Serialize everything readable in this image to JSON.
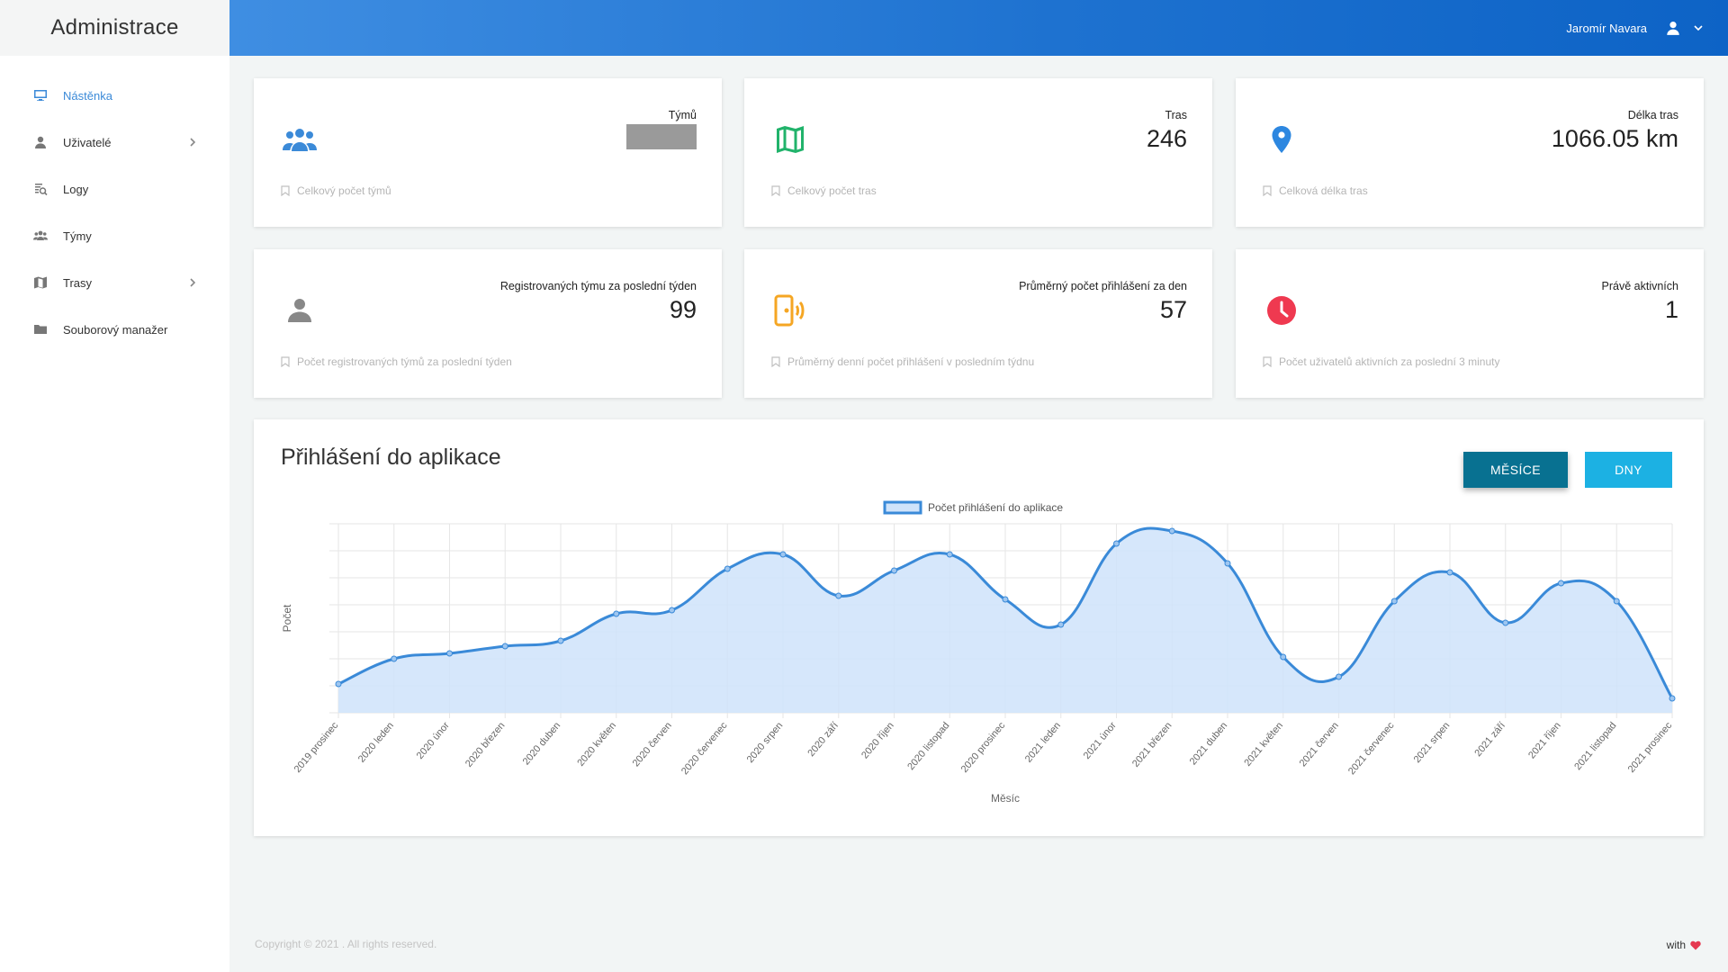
{
  "sidebar": {
    "brand": "Administrace",
    "items": [
      {
        "label": "Nástěnka",
        "icon": "monitor-icon",
        "active": true,
        "has_children": false
      },
      {
        "label": "Uživatelé",
        "icon": "user-icon",
        "active": false,
        "has_children": true
      },
      {
        "label": "Logy",
        "icon": "log-search-icon",
        "active": false,
        "has_children": false
      },
      {
        "label": "Týmy",
        "icon": "team-icon",
        "active": false,
        "has_children": false
      },
      {
        "label": "Trasy",
        "icon": "map-icon",
        "active": false,
        "has_children": true
      },
      {
        "label": "Souborový manažer",
        "icon": "folder-icon",
        "active": false,
        "has_children": false
      }
    ]
  },
  "header": {
    "user_name": "Jaromír Navara"
  },
  "stats": [
    {
      "title": "Týmů",
      "value": "",
      "redacted": true,
      "footer": "Celkový počet týmů",
      "icon": "team-icon",
      "icon_color": "#3b8ad8"
    },
    {
      "title": "Tras",
      "value": "246",
      "redacted": false,
      "footer": "Celkový počet tras",
      "icon": "map-icon",
      "icon_color": "#21b36b"
    },
    {
      "title": "Délka tras",
      "value": "1066.05 km",
      "redacted": false,
      "footer": "Celková délka tras",
      "icon": "location-pin-icon",
      "icon_color": "#2d87e0"
    },
    {
      "title": "Registrovaných týmu za poslední týden",
      "value": "99",
      "redacted": false,
      "footer": "Počet registrovaných týmů za poslední týden",
      "icon": "user-icon",
      "icon_color": "#888888"
    },
    {
      "title": "Průměrný počet přihlášení za den",
      "value": "57",
      "redacted": false,
      "footer": "Průměrný denní počet přihlášení v posledním týdnu",
      "icon": "phone-signal-icon",
      "icon_color": "#f5a623"
    },
    {
      "title": "Právě aktivních",
      "value": "1",
      "redacted": false,
      "footer": "Počet uživatelů aktivních za poslední 3 minuty",
      "icon": "clock-icon",
      "icon_color": "#ef3950"
    }
  ],
  "chart_section": {
    "title": "Přihlášení do aplikace",
    "btn_months": "MĚSÍCE",
    "btn_days": "DNY"
  },
  "chart_data": {
    "type": "area",
    "title": "",
    "legend": "Počet přihlášení do aplikace",
    "legend_position": "top-center",
    "xlabel": "Měsíc",
    "ylabel": "Počet",
    "grid": true,
    "line_color": "#3a8ad8",
    "fill_color": "#cfe3fa",
    "categories": [
      "2019 prosinec",
      "2020 leden",
      "2020 únor",
      "2020 březen",
      "2020 duben",
      "2020 květen",
      "2020 červen",
      "2020 červenec",
      "2020 srpen",
      "2020 září",
      "2020 říjen",
      "2020 listopad",
      "2020 prosinec",
      "2021 leden",
      "2021 únor",
      "2021 březen",
      "2021 duben",
      "2021 květen",
      "2021 červen",
      "2021 červenec",
      "2021 srpen",
      "2021 září",
      "2021 říjen",
      "2021 listopad",
      "2021 prosinec"
    ],
    "values": [
      16,
      30,
      33,
      37,
      40,
      55,
      57,
      80,
      88,
      65,
      79,
      88,
      63,
      49,
      94,
      101,
      83,
      31,
      20,
      62,
      78,
      50,
      72,
      62,
      8
    ],
    "ylim": [
      0,
      105
    ]
  },
  "footer": {
    "copyright": "Copyright © 2021 . All rights reserved.",
    "with": "with"
  }
}
